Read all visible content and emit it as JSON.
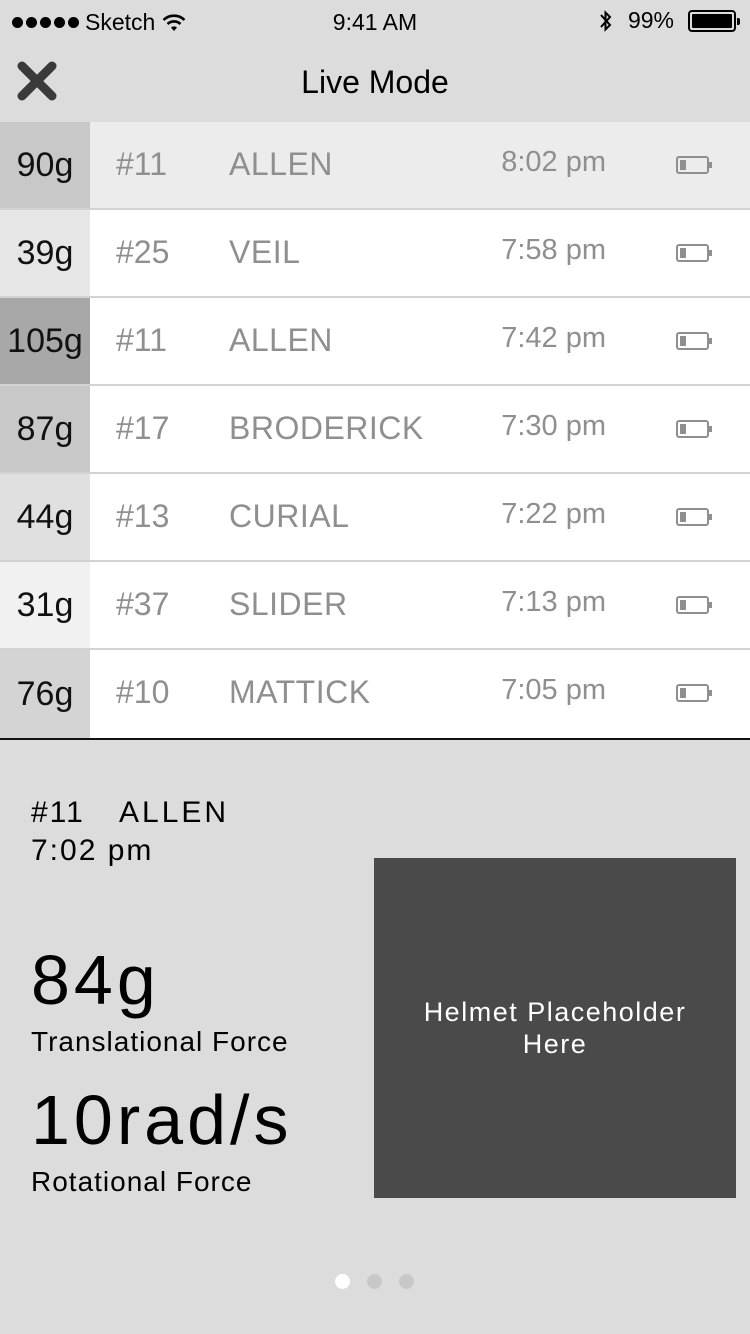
{
  "status_bar": {
    "carrier": "Sketch",
    "time": "9:41 AM",
    "battery": "99%"
  },
  "nav": {
    "title": "Live Mode"
  },
  "rows": [
    {
      "force": "90g",
      "number": "#11",
      "name": "ALLEN",
      "time": "8:02 pm",
      "force_color": "#c8c8c8"
    },
    {
      "force": "39g",
      "number": "#25",
      "name": "VEIL",
      "time": "7:58 pm",
      "force_color": "#e6e6e6"
    },
    {
      "force": "105g",
      "number": "#11",
      "name": "ALLEN",
      "time": "7:42 pm",
      "force_color": "#a8a8a8"
    },
    {
      "force": "87g",
      "number": "#17",
      "name": "BRODERICK",
      "time": "7:30 pm",
      "force_color": "#c8c8c8"
    },
    {
      "force": "44g",
      "number": "#13",
      "name": "CURIAL",
      "time": "7:22 pm",
      "force_color": "#e0e0e0"
    },
    {
      "force": "31g",
      "number": "#37",
      "name": "SLIDER",
      "time": "7:13 pm",
      "force_color": "#f1f1f1"
    },
    {
      "force": "76g",
      "number": "#10",
      "name": "MATTICK",
      "time": "7:05 pm",
      "force_color": "#d4d4d4"
    }
  ],
  "detail": {
    "number": "#11",
    "name": "ALLEN",
    "time": "7:02 pm",
    "translational_value": "84g",
    "translational_label": "Translational Force",
    "rotational_value": "10rad/s",
    "rotational_label": "Rotational Force",
    "helmet_placeholder": "Helmet Placeholder Here"
  },
  "pager": {
    "pages": 3,
    "active": 0
  }
}
